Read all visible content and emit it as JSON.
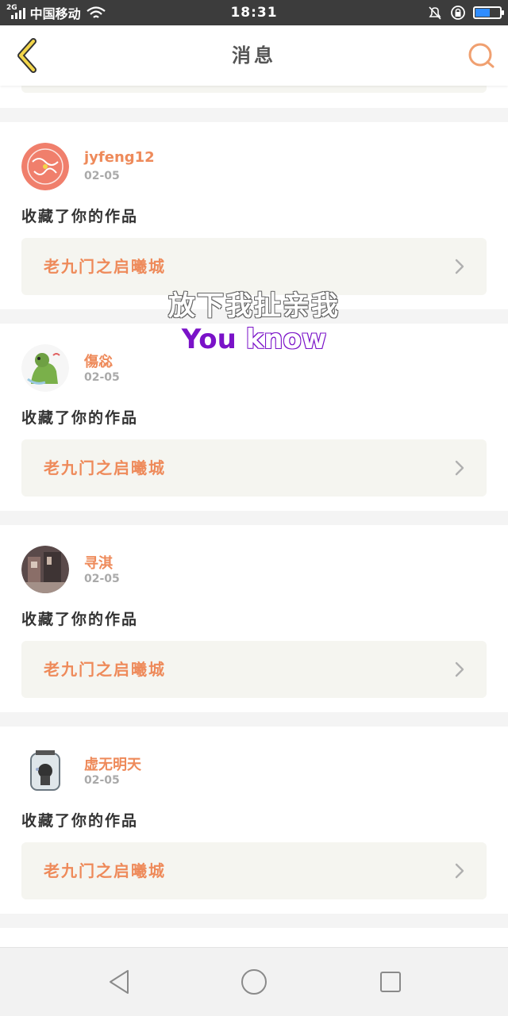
{
  "status_bar": {
    "network_type": "2G",
    "carrier": "中国移动",
    "time": "18:31",
    "battery_color": "#2f8cff",
    "battery_level": 0.55
  },
  "header": {
    "title": "消息",
    "back_icon": "chevron-left-icon",
    "search_icon": "search-icon",
    "accent_color": "#f0a070"
  },
  "watermark": {
    "line1": "放下我扯亲我",
    "line2_part1": "You",
    "line2_part2": "know"
  },
  "messages": [
    {
      "username": "jyfeng12",
      "date": "02-05",
      "action": "收藏了你的作品",
      "work_title": "老九门之启曦城"
    },
    {
      "username": "傷惢",
      "date": "02-05",
      "action": "收藏了你的作品",
      "work_title": "老九门之启曦城"
    },
    {
      "username": "寻淇",
      "date": "02-05",
      "action": "收藏了你的作品",
      "work_title": "老九门之启曦城"
    },
    {
      "username": "虚无明天",
      "date": "02-05",
      "action": "收藏了你的作品",
      "work_title": "老九门之启曦城"
    }
  ],
  "nav_bar": {
    "back_icon": "triangle-back-icon",
    "home_icon": "circle-home-icon",
    "recents_icon": "square-recents-icon"
  }
}
